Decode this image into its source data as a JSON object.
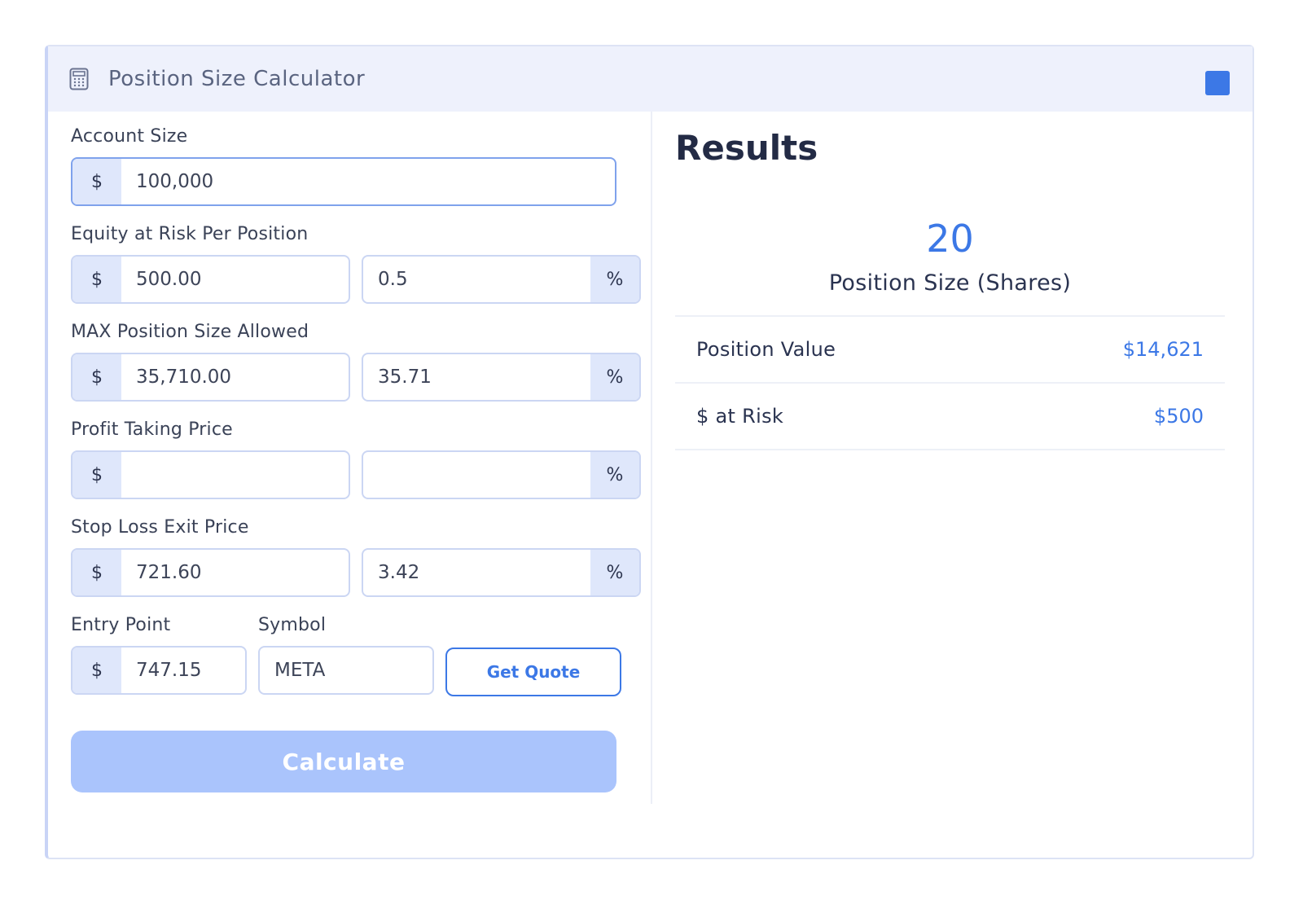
{
  "window": {
    "title": "Position Size Calculator",
    "accent_color": "#3c78e6"
  },
  "form": {
    "account_size": {
      "label": "Account Size",
      "currency": "$",
      "value": "100,000"
    },
    "equity_at_risk": {
      "label": "Equity at Risk Per Position",
      "currency": "$",
      "dollar_value": "500.00",
      "percent_value": "0.5",
      "percent_sign": "%"
    },
    "max_position": {
      "label": "MAX Position Size Allowed",
      "currency": "$",
      "dollar_value": "35,710.00",
      "percent_value": "35.71",
      "percent_sign": "%"
    },
    "profit_taking": {
      "label": "Profit Taking Price",
      "currency": "$",
      "dollar_value": "",
      "percent_value": "",
      "percent_sign": "%"
    },
    "stop_loss": {
      "label": "Stop Loss Exit Price",
      "currency": "$",
      "dollar_value": "721.60",
      "percent_value": "3.42",
      "percent_sign": "%"
    },
    "entry_point": {
      "label": "Entry Point",
      "currency": "$",
      "value": "747.15"
    },
    "symbol": {
      "label": "Symbol",
      "value": "META"
    },
    "get_quote_label": "Get Quote",
    "calculate_label": "Calculate"
  },
  "results": {
    "title": "Results",
    "position_size": "20",
    "position_size_caption": "Position Size (Shares)",
    "rows": [
      {
        "label": "Position Value",
        "value": "$14,621"
      },
      {
        "label": "$ at Risk",
        "value": "$500"
      }
    ]
  },
  "icons": {
    "title_icon": "calculator-icon"
  }
}
